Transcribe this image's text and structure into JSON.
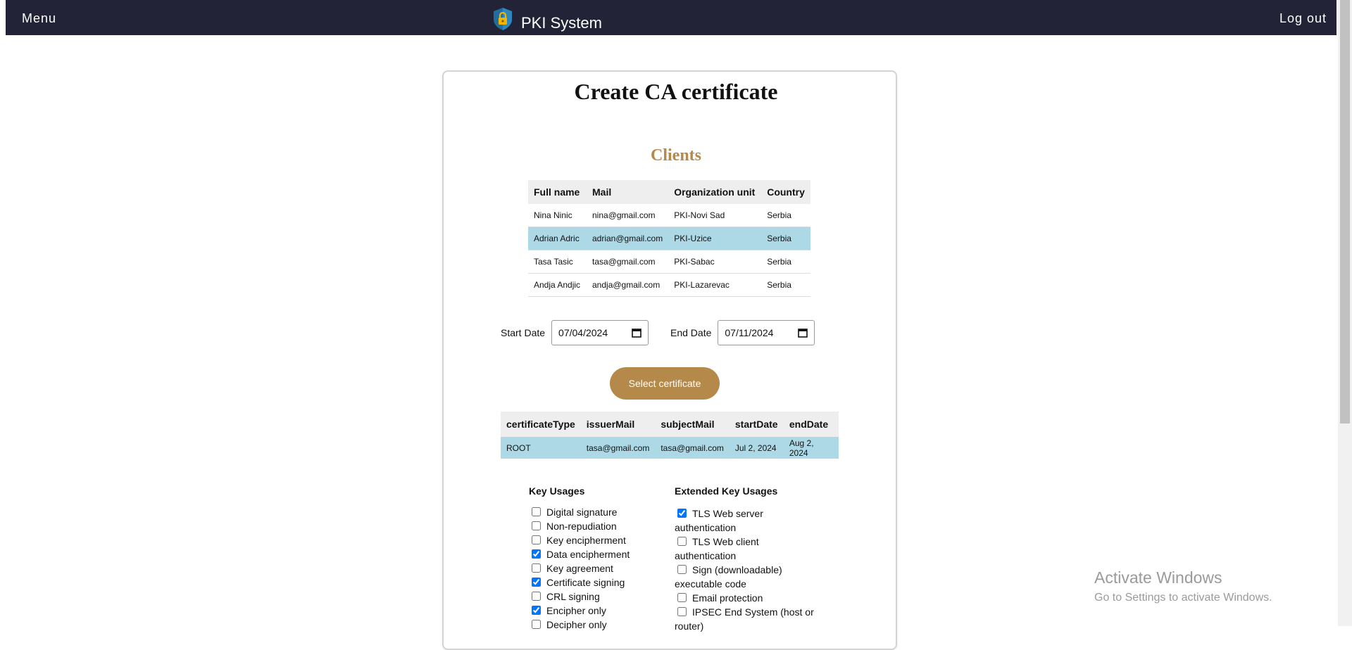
{
  "navbar": {
    "menu_label": "Menu",
    "brand": "PKI System",
    "logout_label": "Log out"
  },
  "page": {
    "title": "Create CA certificate",
    "clients_title": "Clients"
  },
  "clients_table": {
    "headers": [
      "Full name",
      "Mail",
      "Organization unit",
      "Country"
    ],
    "rows": [
      [
        "Nina Ninic",
        "nina@gmail.com",
        "PKI-Novi Sad",
        "Serbia"
      ],
      [
        "Adrian Adric",
        "adrian@gmail.com",
        "PKI-Uzice",
        "Serbia"
      ],
      [
        "Tasa Tasic",
        "tasa@gmail.com",
        "PKI-Sabac",
        "Serbia"
      ],
      [
        "Andja Andjic",
        "andja@gmail.com",
        "PKI-Lazarevac",
        "Serbia"
      ]
    ],
    "selected_row": 1
  },
  "dates": {
    "start_label": "Start Date",
    "start_value": "07/04/2024",
    "end_label": "End Date",
    "end_value": "07/11/2024"
  },
  "select_button_label": "Select certificate",
  "cert_table": {
    "headers": [
      "certificateType",
      "issuerMail",
      "subjectMail",
      "startDate",
      "endDate"
    ],
    "rows": [
      [
        "ROOT",
        "tasa@gmail.com",
        "tasa@gmail.com",
        "Jul 2, 2024",
        "Aug 2, 2024"
      ]
    ]
  },
  "key_usages": {
    "heading": "Key Usages",
    "items": [
      {
        "label": "Digital signature",
        "checked": false
      },
      {
        "label": "Non-repudiation",
        "checked": false
      },
      {
        "label": "Key encipherment",
        "checked": false
      },
      {
        "label": "Data encipherment",
        "checked": true
      },
      {
        "label": "Key agreement",
        "checked": false
      },
      {
        "label": "Certificate signing",
        "checked": true
      },
      {
        "label": "CRL signing",
        "checked": false
      },
      {
        "label": "Encipher only",
        "checked": true
      },
      {
        "label": "Decipher only",
        "checked": false
      }
    ]
  },
  "extended_key_usages": {
    "heading": "Extended Key Usages",
    "items": [
      {
        "label": "TLS Web server authentication",
        "checked": true
      },
      {
        "label": "TLS Web client authentication",
        "checked": false
      },
      {
        "label": "Sign (downloadable) executable code",
        "checked": false
      },
      {
        "label": "Email protection",
        "checked": false
      },
      {
        "label": "IPSEC End System (host or router)",
        "checked": false
      }
    ]
  },
  "watermark": {
    "line1": "Activate Windows",
    "line2": "Go to Settings to activate Windows."
  },
  "colors": {
    "navbar_bg": "#232338",
    "accent": "#b5894a",
    "selected_row": "#add8e6"
  }
}
